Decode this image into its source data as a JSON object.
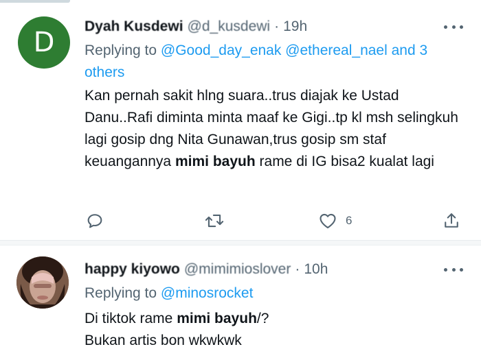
{
  "tweets": [
    {
      "avatar_letter": "D",
      "avatar_color": "#2e7d32",
      "display_name": "Dyah Kusdewi",
      "handle": "@d_kusdewi",
      "time": "19h",
      "replying_prefix": "Replying to",
      "replying_mentions": "@Good_day_enak @ethereal_nael",
      "replying_and": "and",
      "replying_others": "3 others",
      "text_before": "Kan pernah sakit hlng suara..trus diajak ke Ustad Danu..Rafi diminta minta maaf ke Gigi..tp kl msh selingkuh lagi gosip dng Nita Gunawan,trus gosip sm staf keuangannya",
      "text_bold": "mimi bayuh",
      "text_after": "rame di IG bisa2 kualat lagi",
      "like_count": "6",
      "icons": [
        "reply-icon",
        "retweet-icon",
        "like-icon",
        "share-icon",
        "more-icon"
      ]
    },
    {
      "display_name": "happy kiyowo",
      "handle": "@mimimioslover",
      "time": "10h",
      "replying_prefix": "Replying to",
      "replying_mentions": "@minosrocket",
      "line1_before": "Di tiktok rame",
      "line1_bold": "mimi bayuh",
      "line1_after": "/?",
      "line2": "Bukan artis bon wkwkwk",
      "icons": [
        "more-icon"
      ]
    }
  ],
  "colors": {
    "accent": "#1d9bf0",
    "secondary_text": "#536471",
    "primary_text": "#0f1419"
  }
}
